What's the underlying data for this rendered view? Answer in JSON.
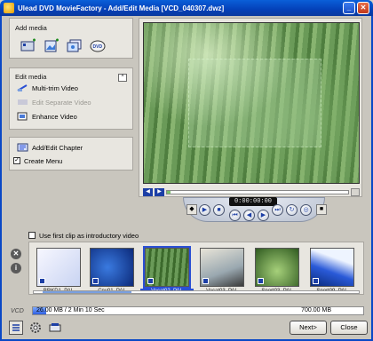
{
  "window": {
    "title": "Ulead DVD MovieFactory - Add/Edit Media [VCD_040307.dwz]",
    "min_label": "_",
    "close_label": "✕"
  },
  "add_media": {
    "label": "Add media",
    "buttons": [
      "add-video-icon",
      "add-image-icon",
      "add-slideshow-icon",
      "add-dvd-icon"
    ]
  },
  "edit_media": {
    "label": "Edit media",
    "collapse_glyph": "^",
    "items": [
      {
        "label": "Multi-trim Video",
        "enabled": true
      },
      {
        "label": "Edit Separate Video",
        "enabled": false
      },
      {
        "label": "Enhance Video",
        "enabled": true
      }
    ]
  },
  "chapters": {
    "add_edit_label": "Add/Edit Chapter",
    "create_menu_label": "Create Menu",
    "create_menu_checked": true
  },
  "player": {
    "timecode": "0:00:00:00",
    "seek_fraction": 0.02
  },
  "intro": {
    "label": "Use first clip as introductory video",
    "checked": false
  },
  "clips": [
    {
      "caption": "BRKD1_PAL"
    },
    {
      "caption": "Cnv01_PAL"
    },
    {
      "caption": "Vacat02_PAL"
    },
    {
      "caption": "Vacat03_PAL"
    },
    {
      "caption": "Sport03_PAL"
    },
    {
      "caption": "Sport09_PAL"
    }
  ],
  "selected_clip": 2,
  "capacity": {
    "disc_label": "VCD",
    "used_text": "26.00 MB / 2 Min 10 Sec",
    "max_text": "700.00 MB",
    "used_fraction": 0.04
  },
  "footer": {
    "next_label": "Next>",
    "close_label": "Close"
  },
  "colors": {
    "accent": "#0a48c6",
    "capacity_fill": "#2f60e0"
  }
}
